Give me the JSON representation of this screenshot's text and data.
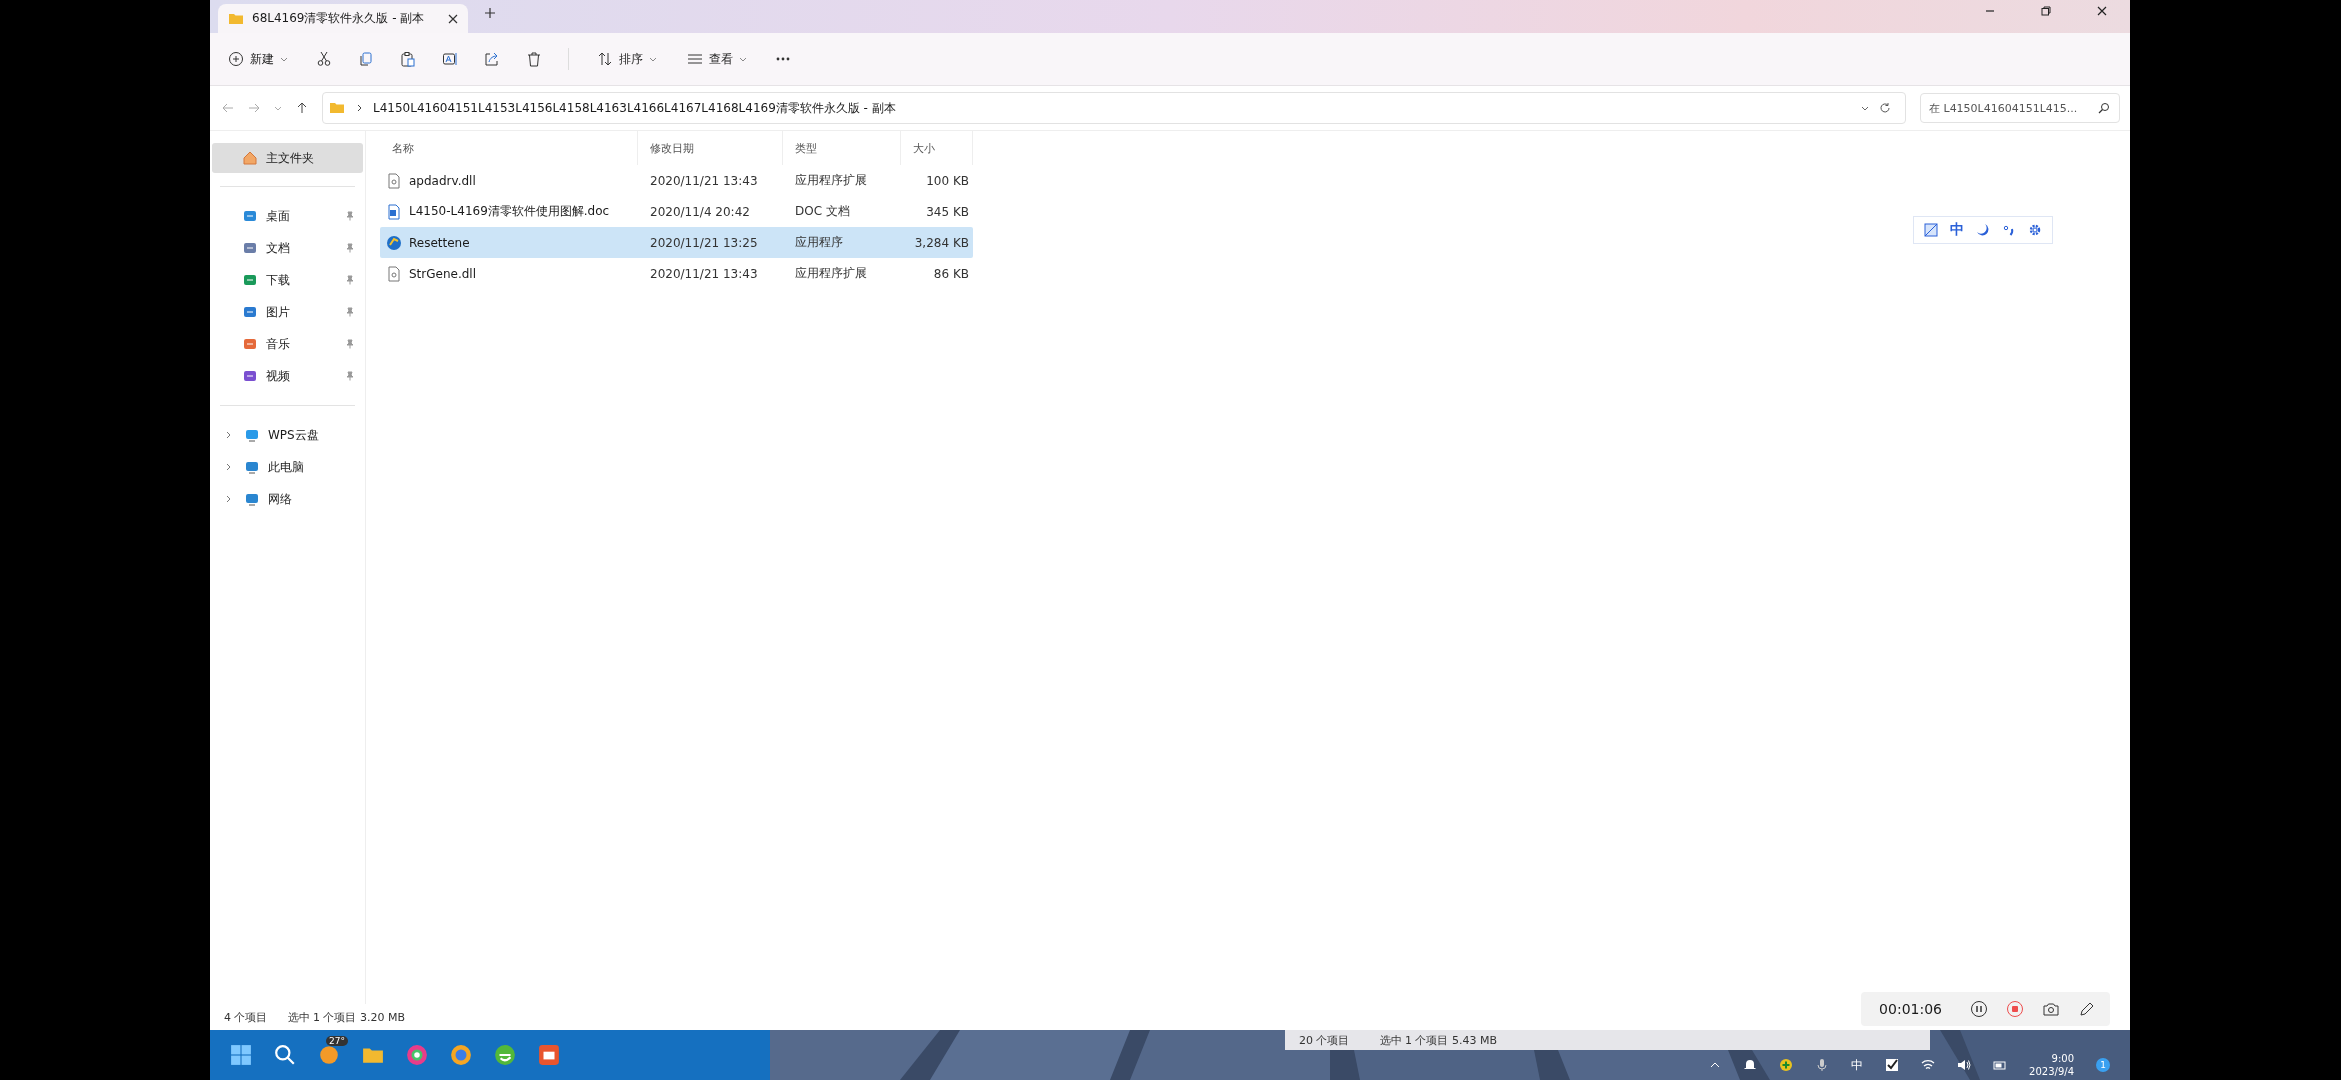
{
  "window": {
    "tab_title": "68L4169清零软件永久版 - 副本"
  },
  "toolbar": {
    "new": "新建",
    "sort": "排序",
    "view": "查看"
  },
  "address": {
    "path": "L4150L41604151L4153L4156L4158L4163L4166L4167L4168L4169清零软件永久版 - 副本",
    "search_placeholder": "在 L4150L41604151L415..."
  },
  "sidebar": {
    "home": {
      "label": "主文件夹",
      "selected": true
    },
    "pinned": [
      {
        "label": "桌面",
        "kind": "desktop"
      },
      {
        "label": "文档",
        "kind": "documents"
      },
      {
        "label": "下载",
        "kind": "downloads"
      },
      {
        "label": "图片",
        "kind": "pictures"
      },
      {
        "label": "音乐",
        "kind": "music"
      },
      {
        "label": "视频",
        "kind": "videos"
      }
    ],
    "locations": [
      {
        "label": "WPS云盘",
        "kind": "cloud"
      },
      {
        "label": "此电脑",
        "kind": "computer"
      },
      {
        "label": "网络",
        "kind": "network"
      }
    ]
  },
  "table": {
    "columns": [
      "名称",
      "修改日期",
      "类型",
      "大小"
    ],
    "rows": [
      {
        "name": "apdadrv.dll",
        "date": "2020/11/21 13:43",
        "type": "应用程序扩展",
        "size": "100 KB",
        "kind": "dll",
        "selected": false
      },
      {
        "name": "L4150-L4169清零软件使用图解.doc",
        "date": "2020/11/4 20:42",
        "type": "DOC 文档",
        "size": "345 KB",
        "kind": "doc",
        "selected": false
      },
      {
        "name": "Resettene",
        "date": "2020/11/21 13:25",
        "type": "应用程序",
        "size": "3,284 KB",
        "kind": "exe",
        "selected": true
      },
      {
        "name": "StrGene.dll",
        "date": "2020/11/21 13:43",
        "type": "应用程序扩展",
        "size": "86 KB",
        "kind": "dll",
        "selected": false
      }
    ]
  },
  "status_bar": {
    "count": "4 个项目",
    "selection": "选中 1 个项目  3.20 MB"
  },
  "ime_toolbar": {
    "mode": "中"
  },
  "recorder": {
    "time": "00:01:06"
  },
  "taskbar": {
    "weather_badge": "27°"
  },
  "background_window_status": {
    "count": "20 个项目",
    "selection": "选中 1 个项目  5.43 MB"
  },
  "tray": {
    "ime": "中",
    "time": "9:00",
    "date": "2023/9/4",
    "notification_count": "1"
  }
}
